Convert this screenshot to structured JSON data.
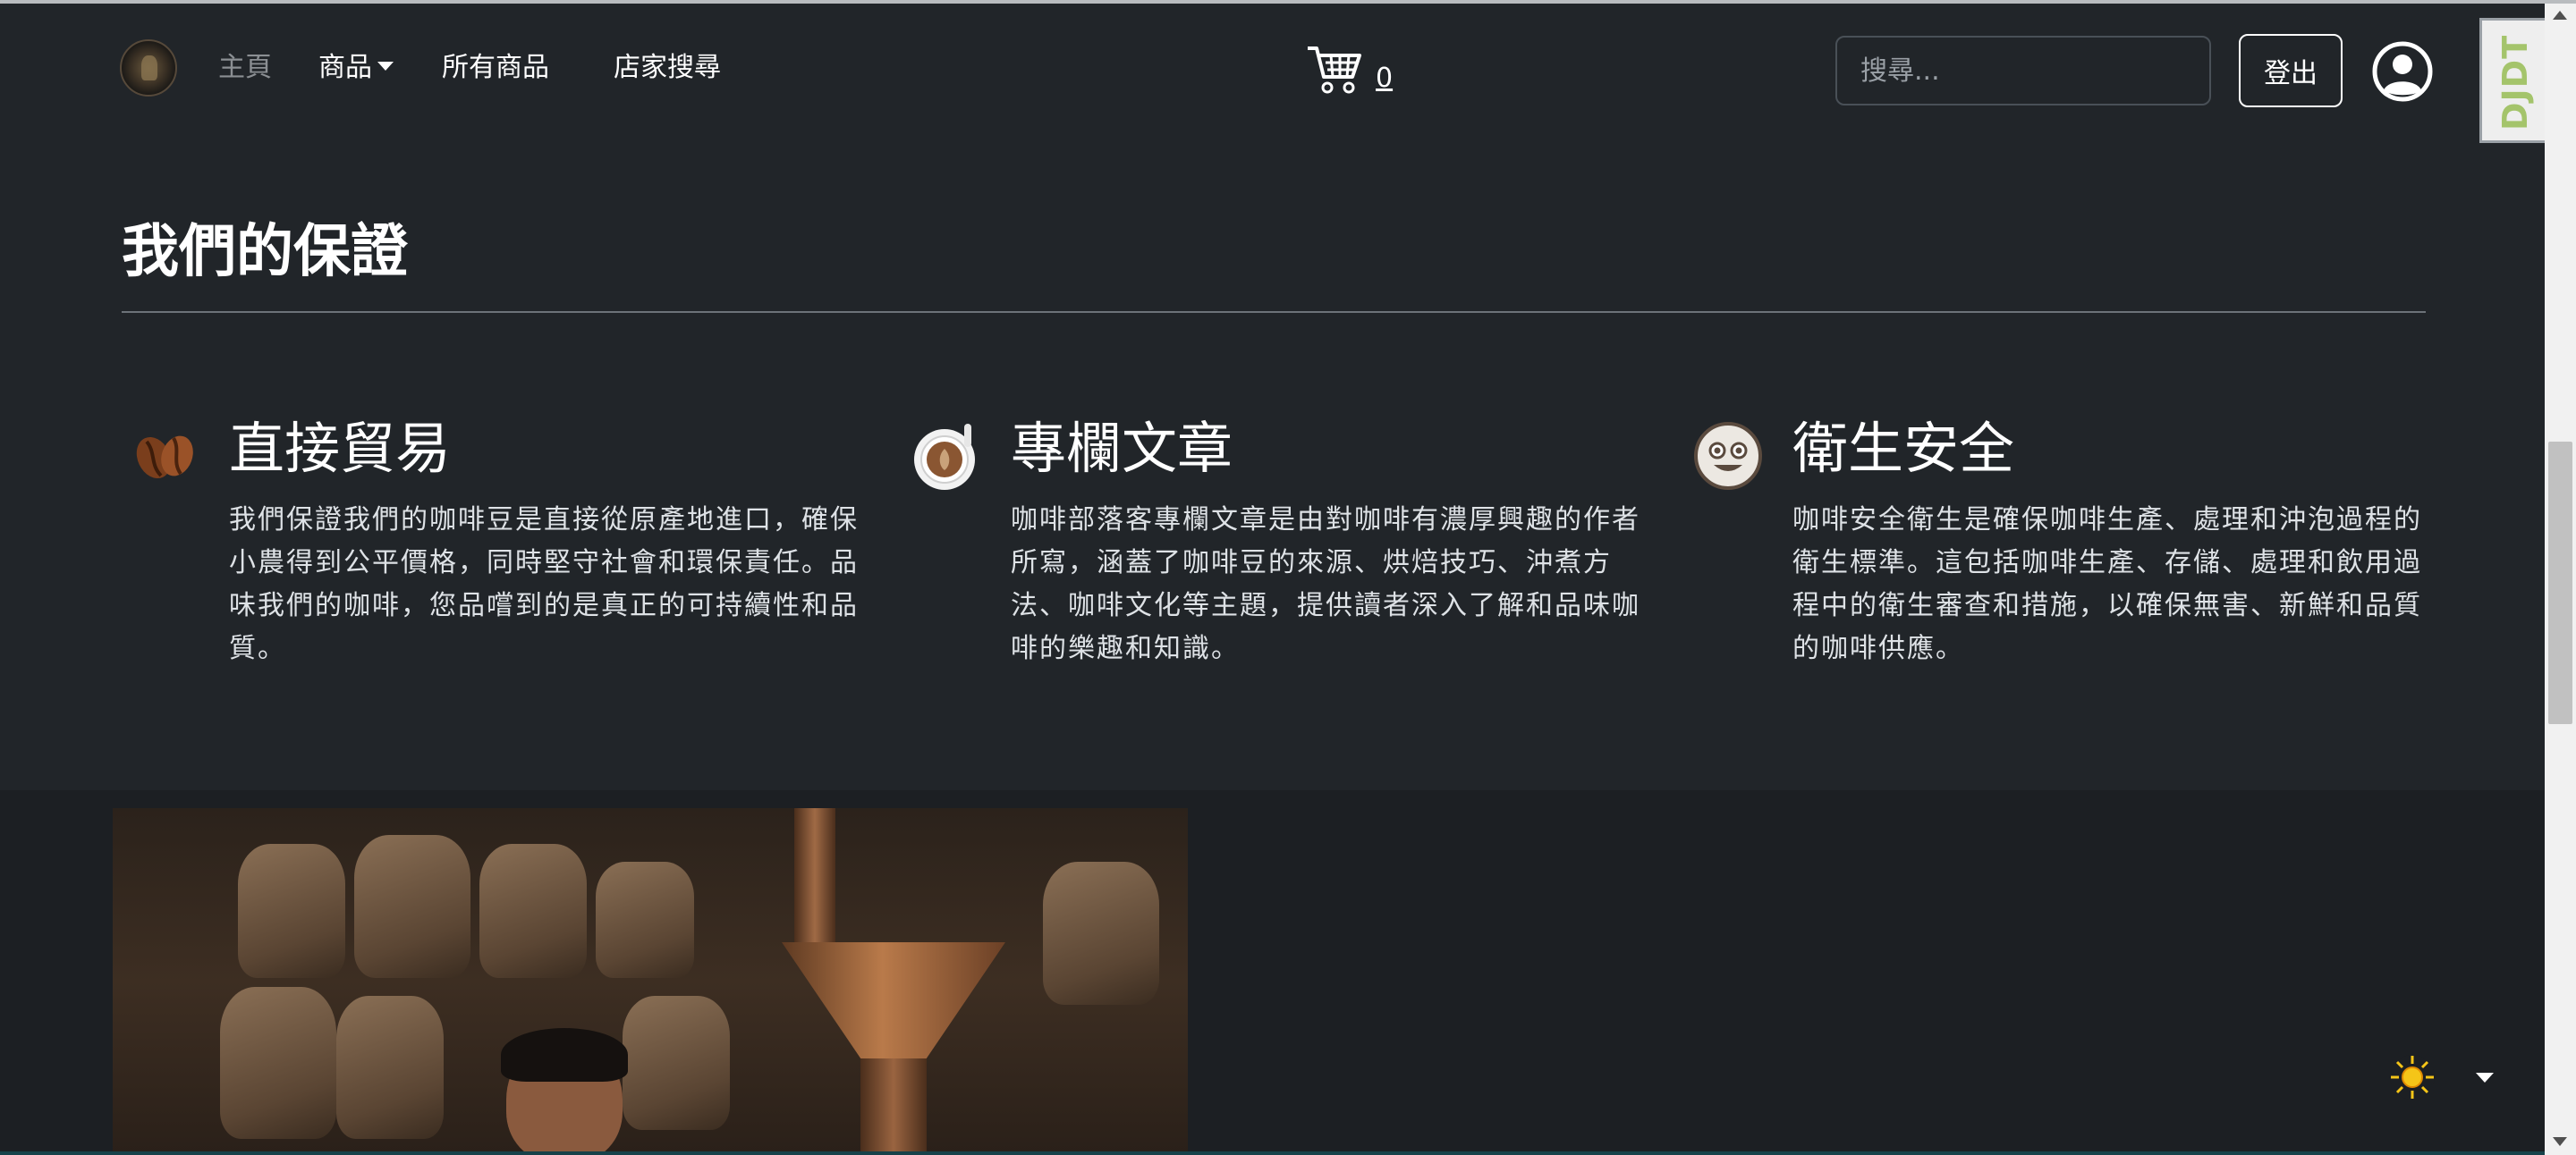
{
  "navbar": {
    "logo_icon": "coffee-logo-icon",
    "home_label": "主頁",
    "products_label": "商品",
    "all_products_label": "所有商品",
    "store_search_label": "店家搜尋",
    "cart_icon": "shopping-cart-icon",
    "cart_count": "0",
    "search_placeholder": "搜尋...",
    "logout_label": "登出",
    "user_icon": "user-circle-icon"
  },
  "debug_toolbar": {
    "label": "DJDT",
    "accent_color": "#a4c46b"
  },
  "guarantee": {
    "title": "我們的保證",
    "features": [
      {
        "icon": "coffee-beans-icon",
        "title": "直接貿易",
        "text": "我們保證我們的咖啡豆是直接從原產地進口，確保小農得到公平價格，同時堅守社會和環保責任。品味我們的咖啡，您品嚐到的是真正的可持續性和品質。"
      },
      {
        "icon": "coffee-cup-icon",
        "title": "專欄文章",
        "text": "咖啡部落客專欄文章是由對咖啡有濃厚興趣的作者所寫，涵蓋了咖啡豆的來源、烘焙技巧、沖煮方法、咖啡文化等主題，提供讀者深入了解和品味咖啡的樂趣和知識。"
      },
      {
        "icon": "smiley-face-icon",
        "title": "衛生安全",
        "text": "咖啡安全衛生是確保咖啡生產、處理和沖泡過程的衛生標準。這包括咖啡生產、存儲、處理和飲用過程中的衛生審查和措施，以確保無害、新鮮和品質的咖啡供應。"
      }
    ]
  },
  "theme_toggle": {
    "icon": "sun-icon",
    "accent_color": "#f5c518"
  },
  "colors": {
    "background": "#212529",
    "lower_band": "#1c1f23",
    "muted_link": "#8b8f93"
  }
}
